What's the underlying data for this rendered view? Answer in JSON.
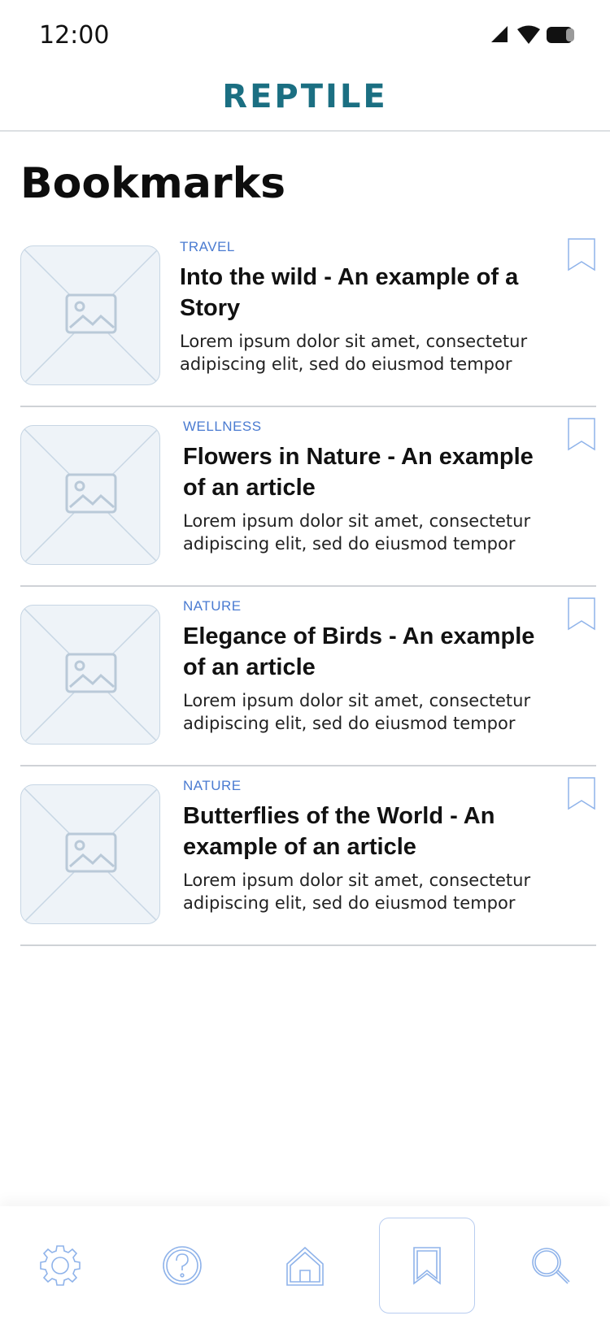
{
  "status_bar": {
    "time": "12:00",
    "icons": [
      "signal-icon",
      "wifi-icon",
      "battery-icon"
    ]
  },
  "header": {
    "logo": "REPTILE",
    "logo_color": "#1b6f82"
  },
  "page": {
    "title": "Bookmarks"
  },
  "bookmarks": [
    {
      "category": "TRAVEL",
      "title": "Into the wild - An example of a Story",
      "description": "Lorem ipsum dolor sit amet, consectetur adipiscing elit, sed do eiusmod tempor",
      "icon": "bookmark-icon"
    },
    {
      "category": "WELLNESS",
      "title": "Flowers in Nature - An example of an article",
      "description": "Lorem ipsum dolor sit amet, consectetur adipiscing elit, sed do eiusmod tempor",
      "icon": "bookmark-icon"
    },
    {
      "category": "NATURE",
      "title": "Elegance of Birds - An example of an article",
      "description": "Lorem ipsum dolor sit amet, consectetur adipiscing elit, sed do eiusmod tempor",
      "icon": "bookmark-icon"
    },
    {
      "category": "NATURE",
      "title": "Butterflies of the World - An example of an article",
      "description": "Lorem ipsum dolor sit amet, consectetur adipiscing elit, sed do eiusmod tempor",
      "icon": "bookmark-icon"
    }
  ],
  "bottom_nav": {
    "active": "bookmarks",
    "items": [
      {
        "id": "settings",
        "icon": "gear-icon"
      },
      {
        "id": "help",
        "icon": "help-icon"
      },
      {
        "id": "home",
        "icon": "home-icon"
      },
      {
        "id": "bookmarks",
        "icon": "bookmark-icon"
      },
      {
        "id": "search",
        "icon": "search-icon"
      }
    ]
  },
  "colors": {
    "category_text": "#4a7bd1",
    "nav_icon": "#8fb3ea",
    "divider": "#cfd2d6",
    "placeholder_bg": "#eef3f8"
  }
}
